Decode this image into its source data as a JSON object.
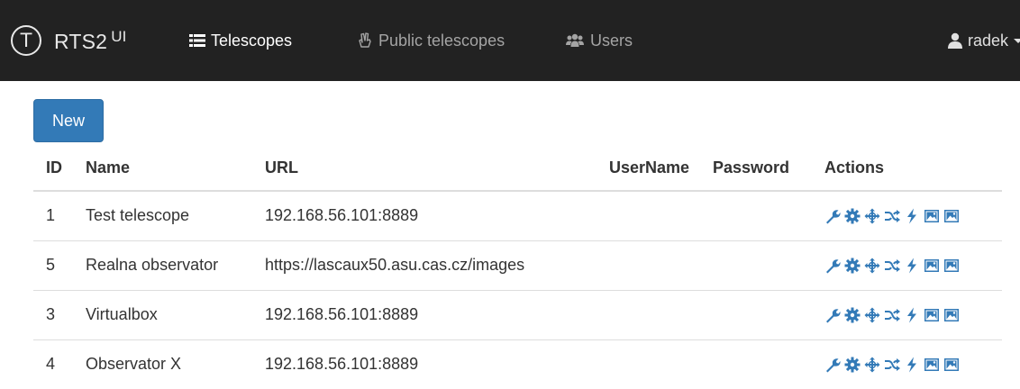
{
  "navbar": {
    "logo_letter": "T",
    "brand_name": "RTS2",
    "brand_suffix": "UI",
    "items": [
      {
        "label": "Telescopes",
        "icon": "list-icon",
        "active": true
      },
      {
        "label": "Public telescopes",
        "icon": "hand-peace-icon",
        "active": false
      },
      {
        "label": "Users",
        "icon": "users-icon",
        "active": false
      }
    ],
    "user": {
      "name": "radek",
      "icon": "user-icon"
    }
  },
  "toolbar": {
    "new_label": "New"
  },
  "table": {
    "columns": [
      "ID",
      "Name",
      "URL",
      "UserName",
      "Password",
      "Actions"
    ],
    "rows": [
      {
        "id": "1",
        "name": "Test telescope",
        "url": "192.168.56.101:8889",
        "username": "",
        "password": ""
      },
      {
        "id": "5",
        "name": "Realna observator",
        "url": "https://lascaux50.asu.cas.cz/images",
        "username": "",
        "password": ""
      },
      {
        "id": "3",
        "name": "Virtualbox",
        "url": "192.168.56.101:8889",
        "username": "",
        "password": ""
      },
      {
        "id": "4",
        "name": "Observator X",
        "url": "192.168.56.101:8889",
        "username": "",
        "password": ""
      }
    ],
    "action_icons": [
      "wrench-icon",
      "cog-icon",
      "move-icon",
      "random-icon",
      "flash-icon",
      "picture-icon",
      "picture-icon"
    ]
  },
  "colors": {
    "navbar_bg": "#222222",
    "primary": "#337ab7",
    "action_icon": "#337ab7"
  }
}
